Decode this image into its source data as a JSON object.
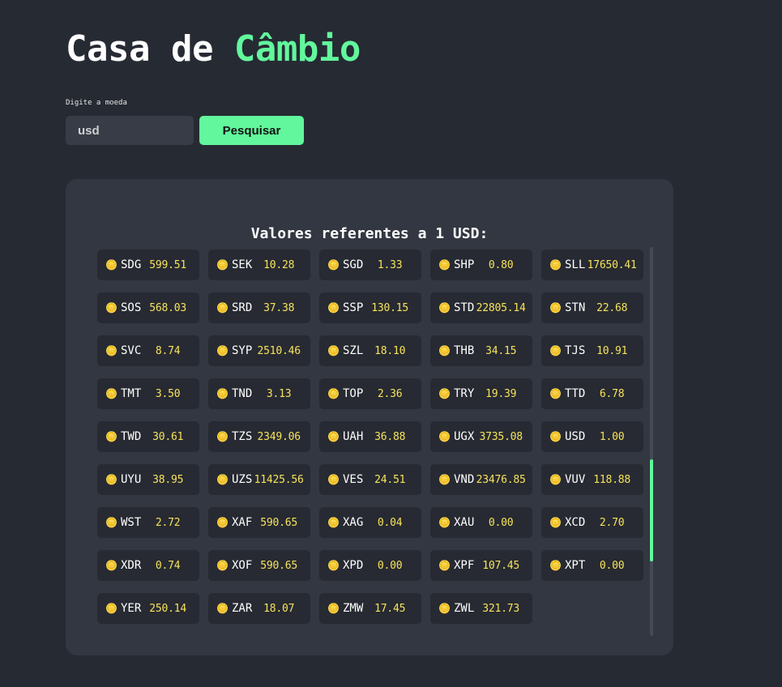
{
  "header": {
    "title_part1": "Casa de ",
    "title_part2": "Câmbio"
  },
  "search": {
    "label": "Digite a moeda",
    "value": "usd",
    "placeholder": "usd",
    "button_label": "Pesquisar"
  },
  "results": {
    "title": "Valores referentes a 1 USD:",
    "coin_icon": "🪙",
    "rates": [
      {
        "code": "SDG",
        "value": "599.51"
      },
      {
        "code": "SEK",
        "value": "10.28"
      },
      {
        "code": "SGD",
        "value": "1.33"
      },
      {
        "code": "SHP",
        "value": "0.80"
      },
      {
        "code": "SLL",
        "value": "17650.41"
      },
      {
        "code": "SOS",
        "value": "568.03"
      },
      {
        "code": "SRD",
        "value": "37.38"
      },
      {
        "code": "SSP",
        "value": "130.15"
      },
      {
        "code": "STD",
        "value": "22805.14"
      },
      {
        "code": "STN",
        "value": "22.68"
      },
      {
        "code": "SVC",
        "value": "8.74"
      },
      {
        "code": "SYP",
        "value": "2510.46"
      },
      {
        "code": "SZL",
        "value": "18.10"
      },
      {
        "code": "THB",
        "value": "34.15"
      },
      {
        "code": "TJS",
        "value": "10.91"
      },
      {
        "code": "TMT",
        "value": "3.50"
      },
      {
        "code": "TND",
        "value": "3.13"
      },
      {
        "code": "TOP",
        "value": "2.36"
      },
      {
        "code": "TRY",
        "value": "19.39"
      },
      {
        "code": "TTD",
        "value": "6.78"
      },
      {
        "code": "TWD",
        "value": "30.61"
      },
      {
        "code": "TZS",
        "value": "2349.06"
      },
      {
        "code": "UAH",
        "value": "36.88"
      },
      {
        "code": "UGX",
        "value": "3735.08"
      },
      {
        "code": "USD",
        "value": "1.00"
      },
      {
        "code": "UYU",
        "value": "38.95"
      },
      {
        "code": "UZS",
        "value": "11425.56"
      },
      {
        "code": "VES",
        "value": "24.51"
      },
      {
        "code": "VND",
        "value": "23476.85"
      },
      {
        "code": "VUV",
        "value": "118.88"
      },
      {
        "code": "WST",
        "value": "2.72"
      },
      {
        "code": "XAF",
        "value": "590.65"
      },
      {
        "code": "XAG",
        "value": "0.04"
      },
      {
        "code": "XAU",
        "value": "0.00"
      },
      {
        "code": "XCD",
        "value": "2.70"
      },
      {
        "code": "XDR",
        "value": "0.74"
      },
      {
        "code": "XOF",
        "value": "590.65"
      },
      {
        "code": "XPD",
        "value": "0.00"
      },
      {
        "code": "XPF",
        "value": "107.45"
      },
      {
        "code": "XPT",
        "value": "0.00"
      },
      {
        "code": "YER",
        "value": "250.14"
      },
      {
        "code": "ZAR",
        "value": "18.07"
      },
      {
        "code": "ZMW",
        "value": "17.45"
      },
      {
        "code": "ZWL",
        "value": "321.73"
      }
    ],
    "scroll_position": 0.74
  },
  "colors": {
    "background": "#262a33",
    "panel": "#333741",
    "card": "#272a32",
    "accent": "#62f79c",
    "value_text": "#f7e35a"
  }
}
